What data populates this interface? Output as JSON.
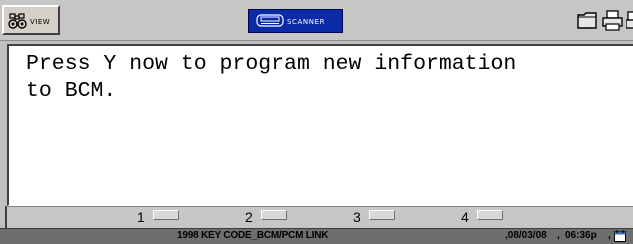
{
  "toolbar": {
    "view_label": "VIEW",
    "view_icon": "binoculars-icon",
    "scanner_label": "SCANNER",
    "scanner_icon": "scanner-tool-icon",
    "right_icons": [
      "folder-icon",
      "printer-icon",
      "communication-icon"
    ]
  },
  "message": {
    "text": "Press Y now to program new information\nto BCM."
  },
  "function_keys": [
    {
      "label": "1"
    },
    {
      "label": "2"
    },
    {
      "label": "3"
    },
    {
      "label": "4"
    }
  ],
  "status_bar": {
    "title": "1998 KEY CODE_BCM/PCM LINK",
    "separator": ",",
    "date": ",08/03/08",
    "time": "06:36p",
    "icon": "calendar-icon"
  },
  "colors": {
    "toolbar_bg": "#c6c6c6",
    "scanner_bg": "#0a2aa6",
    "panel_bg": "#ffffff",
    "status_bg": "#6e6e6e"
  }
}
